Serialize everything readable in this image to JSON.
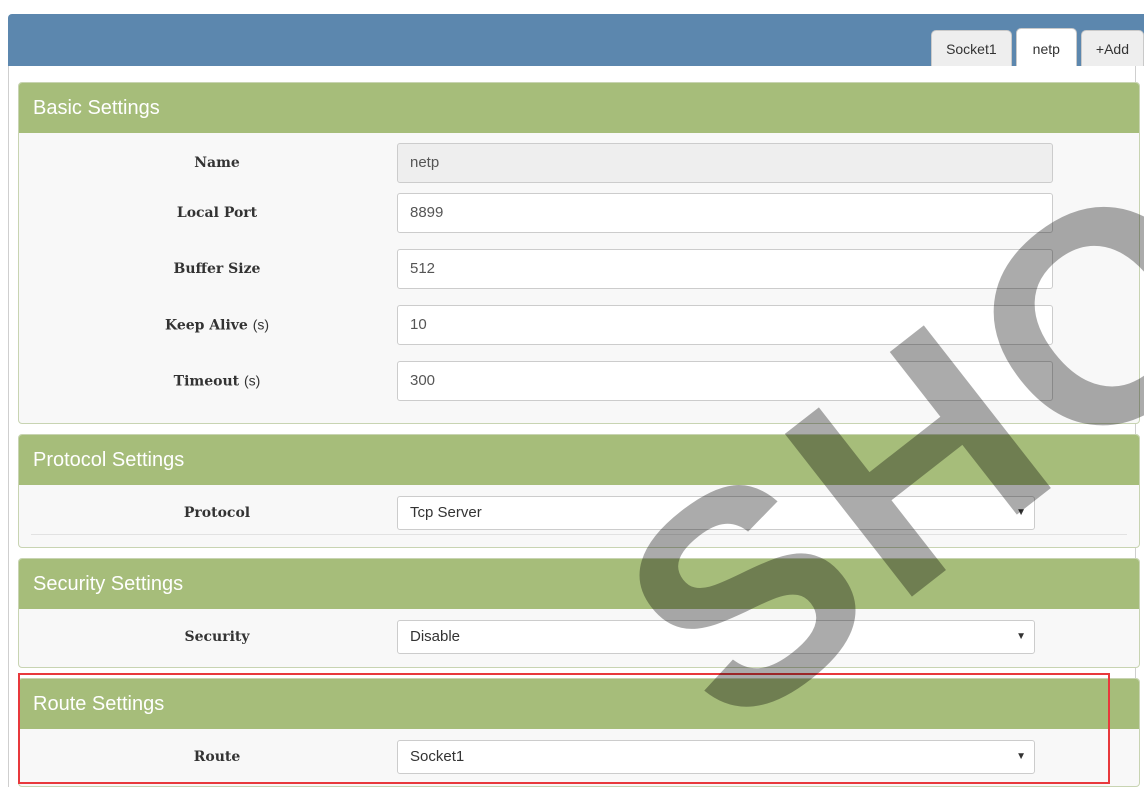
{
  "tabs": [
    {
      "label": "Socket1"
    },
    {
      "label": "netp",
      "active": true
    },
    {
      "label": "+Add"
    }
  ],
  "basic": {
    "title": "Basic Settings",
    "name": {
      "label": "Name",
      "value": "netp"
    },
    "local_port": {
      "label": "Local Port",
      "value": "8899"
    },
    "buffer_size": {
      "label": "Buffer Size",
      "value": "512"
    },
    "keep_alive": {
      "label": "Keep Alive",
      "unit": "(s)",
      "value": "10"
    },
    "timeout": {
      "label": "Timeout",
      "unit": "(s)",
      "value": "300"
    }
  },
  "protocol": {
    "title": "Protocol Settings",
    "label": "Protocol",
    "value": "Tcp Server"
  },
  "security": {
    "title": "Security Settings",
    "label": "Security",
    "value": "Disable"
  },
  "route": {
    "title": "Route Settings",
    "label": "Route",
    "value": "Socket1"
  },
  "select_arrow": "▼",
  "watermark": "SHOP",
  "colors": {
    "topbar": "#5c87ae",
    "panel_header": "#a6bd7a",
    "highlight": "#e8393c"
  }
}
